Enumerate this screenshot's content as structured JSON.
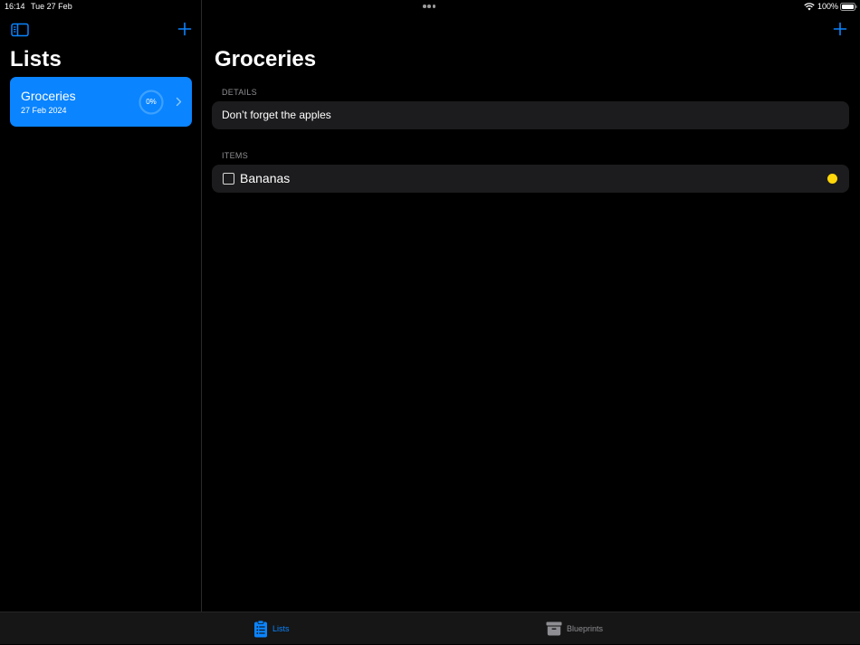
{
  "status_bar": {
    "time": "16:14",
    "date": "Tue 27 Feb",
    "battery": "100%"
  },
  "sidebar": {
    "title": "Lists",
    "toggle_icon": "sidebar-icon",
    "add_icon": "plus-icon",
    "lists": [
      {
        "name": "Groceries",
        "date": "27 Feb 2024",
        "progress": "0%"
      }
    ]
  },
  "detail": {
    "title": "Groceries",
    "add_icon": "plus-icon",
    "details_header": "DETAILS",
    "details_text": "Don’t forget the apples",
    "items_header": "ITEMS",
    "items": [
      {
        "label": "Bananas",
        "checked": false,
        "priority_color": "#ffd60a"
      }
    ]
  },
  "tab_bar": {
    "tabs": [
      {
        "label": "Lists",
        "icon": "clipboard-list-icon",
        "active": true
      },
      {
        "label": "Blueprints",
        "icon": "archive-box-icon",
        "active": false
      }
    ]
  },
  "colors": {
    "accent": "#0a84ff",
    "background": "#000000",
    "cell": "#1c1c1e",
    "inactive_tab": "#8e8e93"
  }
}
